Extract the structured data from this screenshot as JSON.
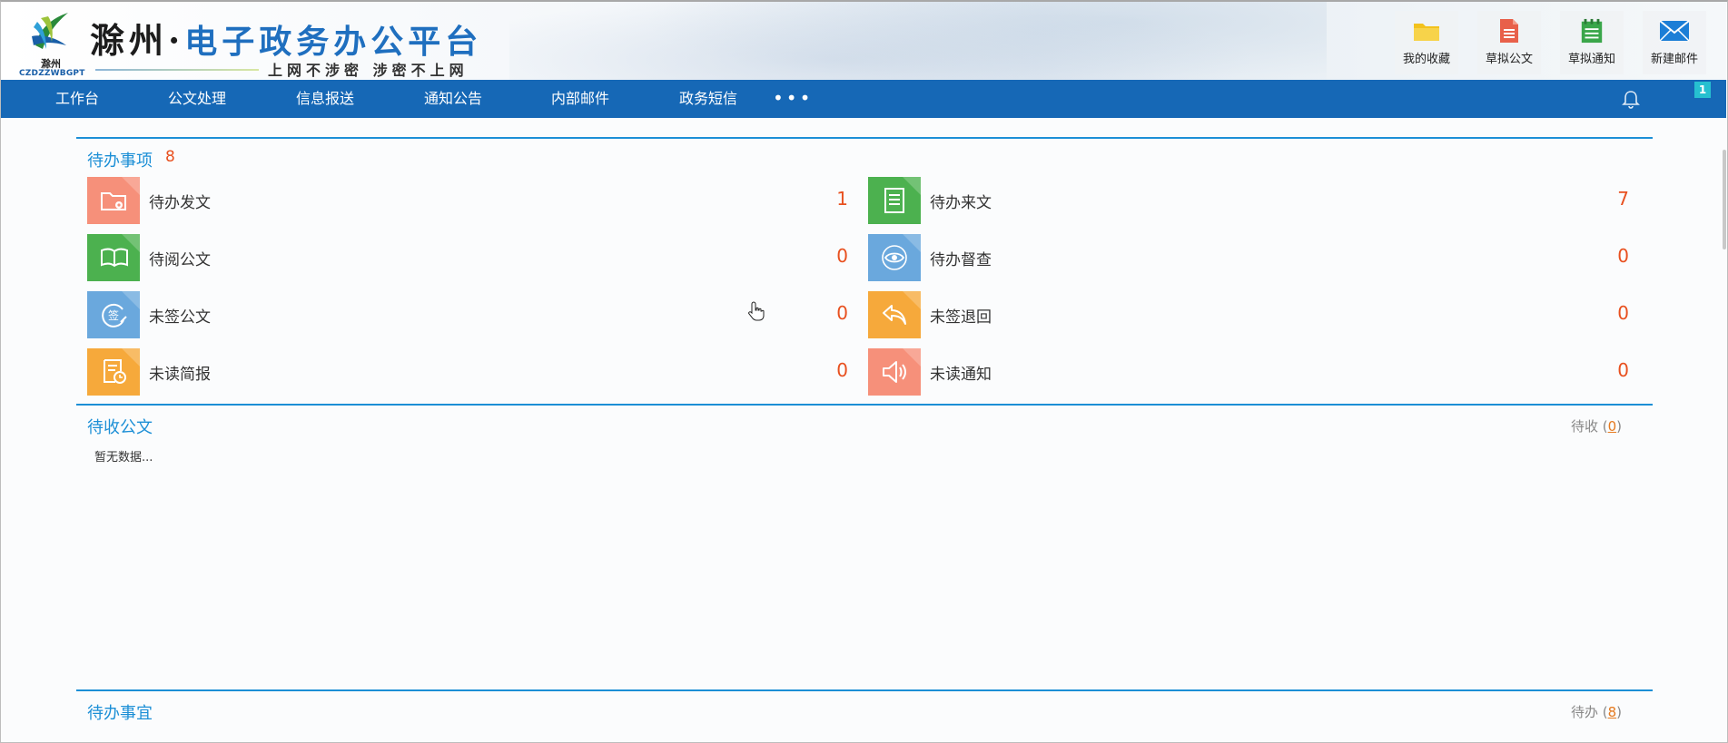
{
  "header": {
    "logo": {
      "city": "滁州",
      "abbr": "CZDZZWBGPT"
    },
    "title_city": "滁州",
    "title_dot": "·",
    "title_platform": "电子政务办公平台",
    "subtitle": "上网不涉密 涉密不上网",
    "quick_actions": [
      {
        "label": "我的收藏",
        "icon": "folder-icon",
        "color": "#f3c21c"
      },
      {
        "label": "草拟公文",
        "icon": "document-draft-icon",
        "color": "#e8604a"
      },
      {
        "label": "草拟通知",
        "icon": "notepad-icon",
        "color": "#3aa64a"
      },
      {
        "label": "新建邮件",
        "icon": "envelope-icon",
        "color": "#1c7ed6"
      }
    ]
  },
  "nav": {
    "items": [
      "工作台",
      "公文处理",
      "信息报送",
      "通知公告",
      "内部邮件",
      "政务短信"
    ],
    "more": "•••",
    "notification_badge": "1"
  },
  "todo": {
    "title": "待办事项",
    "count": "8",
    "items": [
      {
        "label": "待办发文",
        "value": "1",
        "icon": "folder-gear-icon",
        "color": "#f6907a"
      },
      {
        "label": "待办来文",
        "value": "7",
        "icon": "document-lines-icon",
        "color": "#4cb14f"
      },
      {
        "label": "待阅公文",
        "value": "0",
        "icon": "open-book-icon",
        "color": "#4cb14f"
      },
      {
        "label": "待办督查",
        "value": "0",
        "icon": "eye-icon",
        "color": "#6aa8dd"
      },
      {
        "label": "未签公文",
        "value": "0",
        "icon": "sign-icon",
        "color": "#6aa8dd"
      },
      {
        "label": "未签退回",
        "value": "0",
        "icon": "reply-arrow-icon",
        "color": "#f6a93b"
      },
      {
        "label": "未读简报",
        "value": "0",
        "icon": "report-clock-icon",
        "color": "#f6a93b"
      },
      {
        "label": "未读通知",
        "value": "0",
        "icon": "speaker-icon",
        "color": "#f6907a"
      }
    ]
  },
  "receive": {
    "title": "待收公文",
    "right_label": "待收",
    "right_count": "0",
    "empty_text": "暂无数据..."
  },
  "pending": {
    "title": "待办事宜",
    "right_label": "待办",
    "right_count": "8"
  }
}
